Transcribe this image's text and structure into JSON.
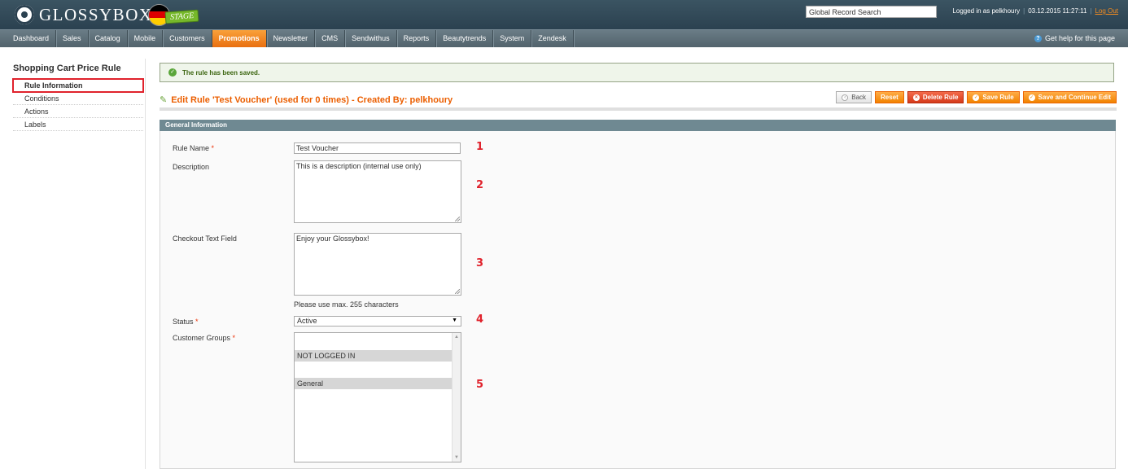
{
  "header": {
    "logo_text": "GLOSSYBOX",
    "stage_badge": "STAGE",
    "global_search_value": "Global Record Search",
    "logged_in_text": "Logged in as pelkhoury",
    "datetime": "03.12.2015 11:27:11",
    "logout_label": "Log Out"
  },
  "nav": {
    "items": [
      "Dashboard",
      "Sales",
      "Catalog",
      "Mobile",
      "Customers",
      "Promotions",
      "Newsletter",
      "CMS",
      "Sendwithus",
      "Reports",
      "Beautytrends",
      "System",
      "Zendesk"
    ],
    "active": "Promotions",
    "help_label": "Get help for this page"
  },
  "sidebar": {
    "title": "Shopping Cart Price Rule",
    "items": [
      "Rule Information",
      "Conditions",
      "Actions",
      "Labels"
    ],
    "active_index": 0
  },
  "messages": {
    "success": "The rule has been saved."
  },
  "page": {
    "title": "Edit Rule 'Test Voucher' (used for 0 times) - Created By: pelkhoury",
    "buttons": {
      "back": "Back",
      "reset": "Reset",
      "delete": "Delete Rule",
      "save": "Save Rule",
      "save_continue": "Save and Continue Edit"
    }
  },
  "form": {
    "section_title": "General Information",
    "rule_name": {
      "label": "Rule Name",
      "value": "Test Voucher"
    },
    "description": {
      "label": "Description",
      "value": "This is a description (internal use only)"
    },
    "checkout_text": {
      "label": "Checkout Text Field",
      "value": "Enjoy your Glossybox!",
      "note": "Please use max. 255 characters"
    },
    "status": {
      "label": "Status",
      "value": "Active"
    },
    "customer_groups": {
      "label": "Customer Groups",
      "options": [
        "NOT LOGGED IN",
        "General"
      ]
    },
    "required_mark": "*"
  },
  "annotations": [
    "1",
    "2",
    "3",
    "4",
    "5"
  ],
  "colors": {
    "accent_orange": "#eb5e00",
    "highlight_red": "#e0222c",
    "header_bg": "#2b4150",
    "section_head_bg": "#6f8992"
  }
}
